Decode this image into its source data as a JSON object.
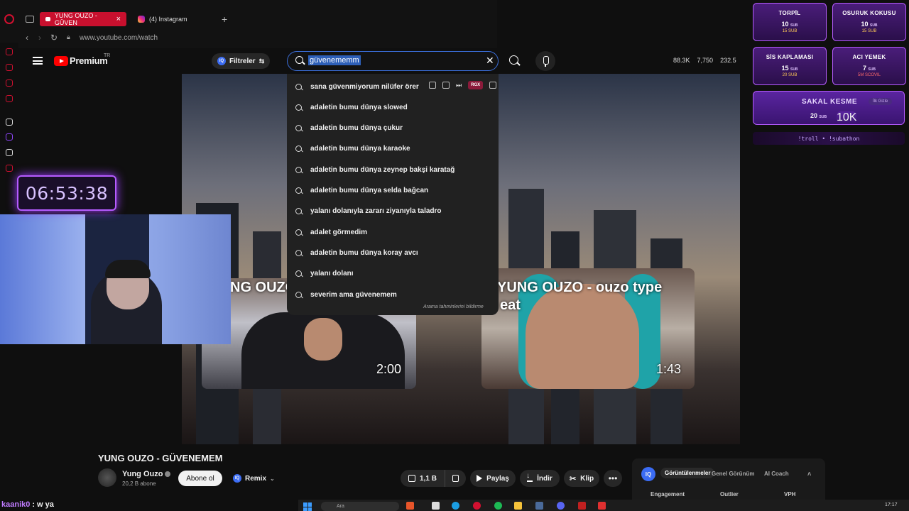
{
  "browser": {
    "tabs": [
      {
        "label": "YUNG OUZO - GÜVEN",
        "active": true
      },
      {
        "label": "(4) Instagram",
        "active": false
      }
    ],
    "new_tab": "+",
    "url": "www.youtube.com/watch"
  },
  "youtube": {
    "logo_text": "Premium",
    "region": "TR",
    "filters_label": "Filtreler",
    "iq_badge": "IQ",
    "search_value": "güvenememm",
    "stats": [
      "88.3K",
      "7,750",
      "232.5"
    ],
    "suggestions": [
      "sana güvenmiyorum nilüfer örer",
      "adaletin bumu dünya slowed",
      "adaletin bumu dünya çukur",
      "adaletin bumu dünya karaoke",
      "adaletin bumu dünya zeynep bakşi karatağ",
      "adaletin bumu dünya selda bağcan",
      "yalanı dolanıyla zararı ziyanıyla taladro",
      "adalet görmedim",
      "adaletin bumu dünya koray avcı",
      "yalanı dolanı",
      "severim ama güvenemem"
    ],
    "suggestions_note": "Arama tahminlerini bildirme",
    "ext_badge": "RGX"
  },
  "video": {
    "thumb1": {
      "title": "NG OUZO",
      "duration": "2:00"
    },
    "thumb2": {
      "title": "YUNG OUZO - ouzo type",
      "title2": "eat",
      "duration": "1:43"
    },
    "title": "YUNG OUZO - GÜVENEMEM",
    "channel": "Yung Ouzo",
    "subscribers": "20,2 B abone",
    "subscribe_label": "Abone ol",
    "remix_label": "Remix",
    "likes": "1,1 B",
    "share_label": "Paylaş",
    "download_label": "İndir",
    "clip_label": "Klip",
    "more_label": "•••"
  },
  "analytics": {
    "tabs": [
      "Görüntülenmeler",
      "Genel Görünüm",
      "AI Coach"
    ],
    "columns": [
      "Engagement",
      "Outlier",
      "VPH"
    ]
  },
  "stream": {
    "timer": "06:53:38",
    "alerts": [
      {
        "title": "TORPİL",
        "amount": "10",
        "unit": "SUB",
        "sub": "15 SUB"
      },
      {
        "title": "OSURUK KOKUSU",
        "amount": "10",
        "unit": "SUB",
        "sub": "15 SUB"
      },
      {
        "title": "SİS KAPLAMASI",
        "amount": "15",
        "unit": "SUB",
        "sub": "20 SUB"
      },
      {
        "title": "ACI YEMEK",
        "amount": "7",
        "unit": "SUB",
        "sub": "5M SCOVIL"
      }
    ],
    "big_alert": {
      "title": "SAKAL KESME",
      "amount": "20",
      "unit": "SUB",
      "extra": "10K",
      "badge": "İlk Gizle"
    },
    "commands": "!troll  •  !subathon",
    "chat": {
      "user": "kaanik0",
      "sep": ":",
      "message": "w ya"
    }
  },
  "taskbar": {
    "search": "Ara",
    "time": "17:17"
  }
}
